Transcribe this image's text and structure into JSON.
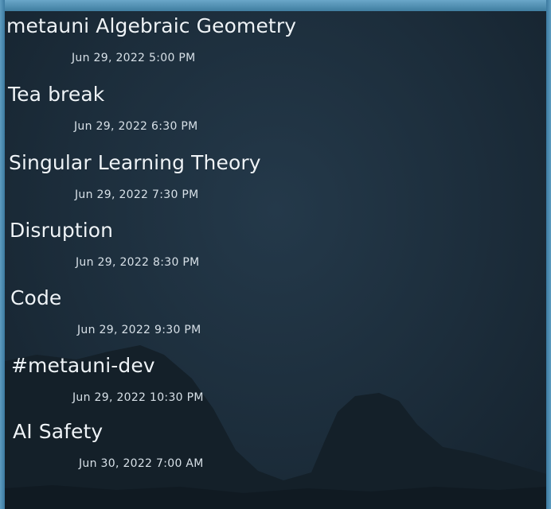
{
  "events": [
    {
      "title": "metauni Algebraic Geometry",
      "time": "Jun 29, 2022 5:00 PM"
    },
    {
      "title": "Tea break",
      "time": "Jun 29, 2022 6:30 PM"
    },
    {
      "title": "Singular Learning Theory",
      "time": "Jun 29, 2022 7:30 PM"
    },
    {
      "title": "Disruption",
      "time": "Jun 29, 2022 8:30 PM"
    },
    {
      "title": "Code",
      "time": "Jun 29, 2022 9:30 PM"
    },
    {
      "title": "#metauni-dev",
      "time": "Jun 29, 2022 10:30 PM"
    },
    {
      "title": "AI Safety",
      "time": "Jun 30, 2022 7:00 AM"
    }
  ]
}
